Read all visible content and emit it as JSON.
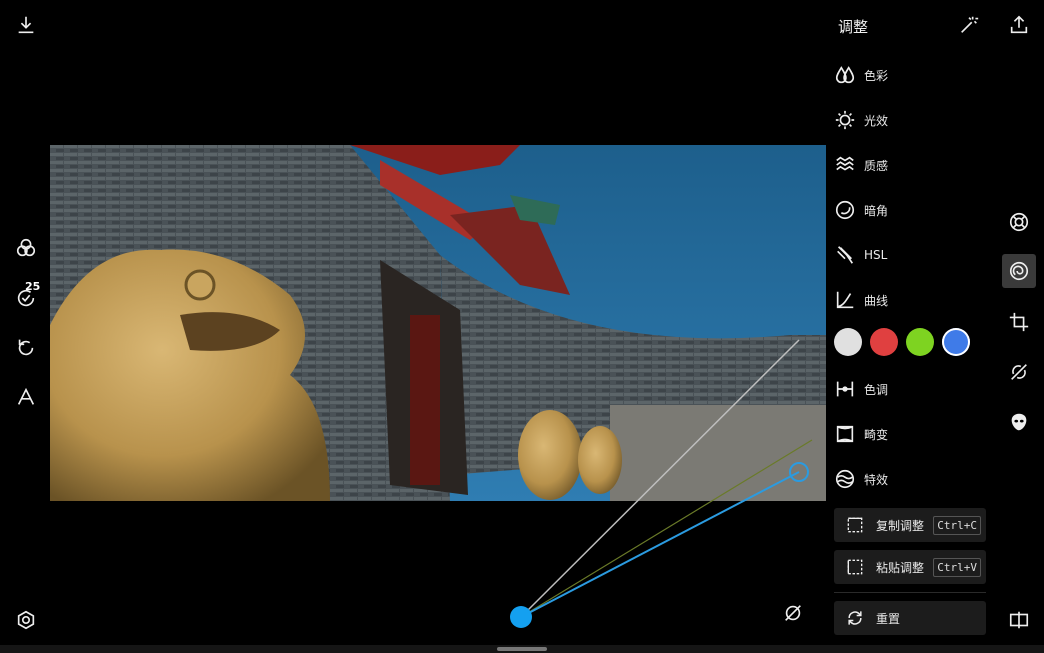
{
  "left_toolbar": {
    "export_icon": "download-icon",
    "filter_icon": "filters-icon",
    "history_badge": "25",
    "undo_icon": "undo-icon",
    "text_icon": "text-icon",
    "settings_icon": "settings-icon"
  },
  "panel": {
    "title": "调整",
    "items": [
      {
        "label": "色彩",
        "icon": "color-drop-icon"
      },
      {
        "label": "光效",
        "icon": "light-sun-icon"
      },
      {
        "label": "质感",
        "icon": "texture-waves-icon"
      },
      {
        "label": "暗角",
        "icon": "vignette-icon"
      },
      {
        "label": "HSL",
        "icon": "hsl-icon"
      },
      {
        "label": "曲线",
        "icon": "curve-icon"
      },
      {
        "label": "色调",
        "icon": "tone-icon"
      },
      {
        "label": "畸变",
        "icon": "distortion-icon"
      },
      {
        "label": "特效",
        "icon": "effects-icon"
      }
    ],
    "curve_channels": [
      {
        "name": "white",
        "color": "#e0e0e0"
      },
      {
        "name": "red",
        "color": "#e04040"
      },
      {
        "name": "green",
        "color": "#7ed321"
      },
      {
        "name": "blue",
        "color": "#3f7be8"
      }
    ],
    "copy": {
      "label": "复制调整",
      "shortcut": "Ctrl+C"
    },
    "paste": {
      "label": "粘贴调整",
      "shortcut": "Ctrl+V"
    },
    "reset": {
      "label": "重置"
    }
  },
  "curve_colors": {
    "point": "#14a0f0",
    "white_line": "#bdbdbd",
    "blue_line": "#2b9be0",
    "green_line": "#6a7a28"
  }
}
